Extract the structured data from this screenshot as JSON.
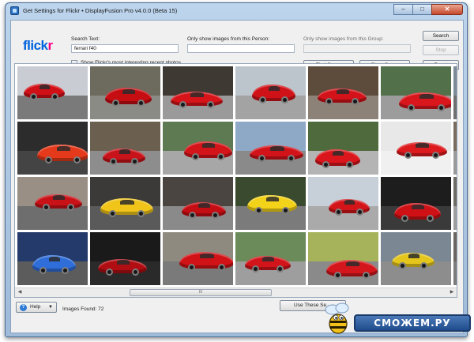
{
  "window": {
    "title": "Get Settings for Flickr • DisplayFusion Pro v4.0.0 (Beta 15)",
    "controls": {
      "minimize": "–",
      "maximize": "□",
      "close": "✕"
    }
  },
  "logo": {
    "part1": "flick",
    "part2": "r"
  },
  "search": {
    "text_label": "Search Text:",
    "text_value": "ferrari f40",
    "person_label": "Only show images from this Person:",
    "person_value": "",
    "group_label": "Only show images from this Group:",
    "group_value": "",
    "interesting_label": "Show Flickr's most interesting recent photos"
  },
  "buttons": {
    "search": "Search",
    "stop": "Stop",
    "find_group": "Find Group",
    "clear_group": "Clear Group",
    "reset": "Reset",
    "help": "Help",
    "use_these": "Use These Se"
  },
  "status": {
    "images_found": "Images Found: 72"
  },
  "watermark": {
    "text": "СМОЖЕМ.РУ"
  },
  "scrollbar": {
    "grip": "III",
    "left": "◀",
    "right": "▶"
  },
  "photos": [
    {
      "bg": "#c9ccd2",
      "car": "#d10f16",
      "ground": "#7a7a7a"
    },
    {
      "bg": "#6d6a5e",
      "car": "#c50d12",
      "ground": "#8b8b86"
    },
    {
      "bg": "#3e3a33",
      "car": "#d6141a",
      "ground": "#9a9a9a"
    },
    {
      "bg": "#bcc4cc",
      "car": "#cf1218",
      "ground": "#a3a3a3"
    },
    {
      "bg": "#5d4b3c",
      "car": "#d3121a",
      "ground": "#8c8277"
    },
    {
      "bg": "#52704a",
      "car": "#d8161c",
      "ground": "#9c9c9c"
    },
    {
      "bg": "#7d8b99",
      "car": "#b81016",
      "ground": "#6f6f6f"
    },
    {
      "bg": "#2c2c2c",
      "car": "#e4391a",
      "ground": "#444444"
    },
    {
      "bg": "#6b5f4f",
      "car": "#c8131a",
      "ground": "#8d8d8d"
    },
    {
      "bg": "#5e7a52",
      "car": "#d31419",
      "ground": "#a7a7a7"
    },
    {
      "bg": "#8ea9c6",
      "car": "#d2141a",
      "ground": "#8a8a8a"
    },
    {
      "bg": "#4f6b3d",
      "car": "#da161c",
      "ground": "#b4b4b4"
    },
    {
      "bg": "#e8e8e8",
      "car": "#dd1a1e",
      "ground": "#f0f0f0"
    },
    {
      "bg": "#7a6d5f",
      "car": "#c9131a",
      "ground": "#9a9a9a"
    },
    {
      "bg": "#9a8f85",
      "car": "#c91218",
      "ground": "#6e6e6e"
    },
    {
      "bg": "#3c3a38",
      "car": "#f0c419",
      "ground": "#5a5a5a"
    },
    {
      "bg": "#4a4540",
      "car": "#c50e14",
      "ground": "#8a8a8a"
    },
    {
      "bg": "#394a2e",
      "car": "#f3d21a",
      "ground": "#7b7b7b"
    },
    {
      "bg": "#c7d0d8",
      "car": "#d3151a",
      "ground": "#aaaaaa"
    },
    {
      "bg": "#1d1d1d",
      "car": "#cf1116",
      "ground": "#3a3a3a"
    },
    {
      "bg": "#6e6a64",
      "car": "#d0141a",
      "ground": "#9d9d9d"
    },
    {
      "bg": "#243a6b",
      "car": "#2f6ed8",
      "ground": "#5c5c5c"
    },
    {
      "bg": "#1a1a1a",
      "car": "#b10e13",
      "ground": "#2a2a2a"
    },
    {
      "bg": "#8e8a7f",
      "car": "#d11217",
      "ground": "#7a7a7a"
    },
    {
      "bg": "#6b8b5a",
      "car": "#d3151b",
      "ground": "#9e9e9e"
    },
    {
      "bg": "#a7b35a",
      "car": "#d4171c",
      "ground": "#8a8a8a"
    },
    {
      "bg": "#7b8792",
      "car": "#e5c61c",
      "ground": "#8d8d8d"
    },
    {
      "bg": "#6a6560",
      "car": "#c8121a",
      "ground": "#7c7c7c"
    }
  ]
}
